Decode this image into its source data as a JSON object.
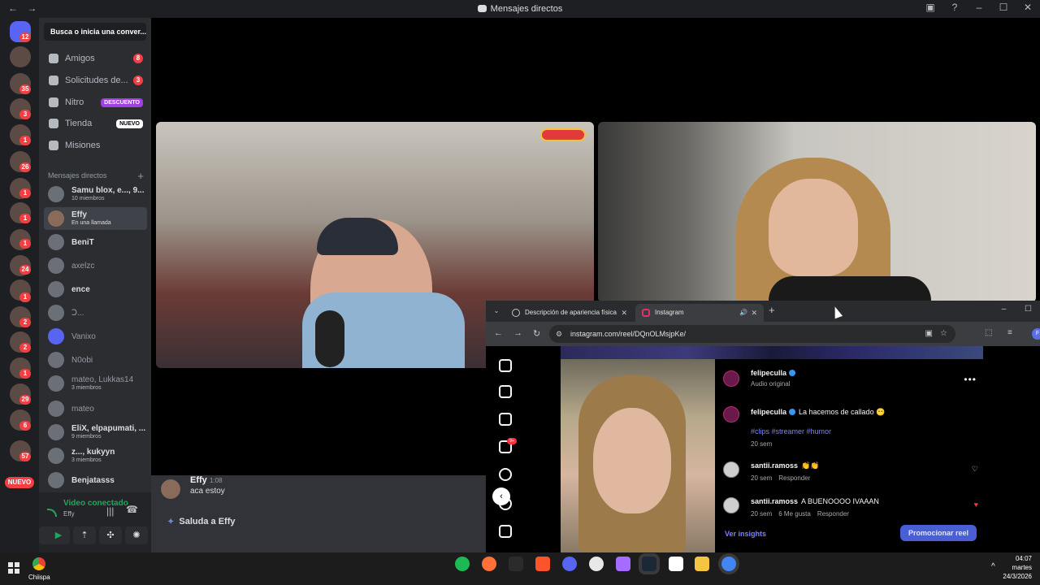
{
  "window": {
    "title": "Mensajes directos",
    "back": "←",
    "forward": "→",
    "controls": [
      "▣",
      "?",
      "–",
      "☐",
      "✕"
    ]
  },
  "rail": {
    "home_badge": "12",
    "badges": [
      "35",
      "3",
      "1",
      "26",
      "1",
      "1",
      "1",
      "24",
      "1",
      "2",
      "2",
      "1",
      "29",
      "6",
      "57"
    ],
    "new_label": "NUEVO"
  },
  "sidebar": {
    "search_placeholder": "Busca o inicia una conver...",
    "nav": [
      {
        "label": "Amigos",
        "count": "8"
      },
      {
        "label": "Solicitudes de...",
        "count": "3"
      },
      {
        "label": "Nitro",
        "tag": "DESCUENTO"
      },
      {
        "label": "Tienda",
        "tag": "NUEVO"
      },
      {
        "label": "Misiones"
      }
    ],
    "dm_header": "Mensajes directos",
    "dm_header_plus": "+",
    "dms": [
      {
        "name": "Samu blox, e..., 9...",
        "sub": "10 miembros"
      },
      {
        "name": "Effy",
        "sub": "En una llamada"
      },
      {
        "name": "BeniT"
      },
      {
        "name": "axelzc"
      },
      {
        "name": "ence"
      },
      {
        "name": "Ↄ..."
      },
      {
        "name": "Vanixo"
      },
      {
        "name": "N0obi"
      },
      {
        "name": "mateo, Lukkas14",
        "sub": "3 miembros"
      },
      {
        "name": "mateo"
      },
      {
        "name": "EliX, elpapumati, ...",
        "sub": "9 miembros"
      },
      {
        "name": "z..., kukyyn",
        "sub": "3 miembros"
      },
      {
        "name": "Benjatasss"
      }
    ]
  },
  "voice": {
    "status": "Video conectado",
    "channel": "Effy"
  },
  "chat": {
    "author": "Effy",
    "time": "1:08",
    "message": "aca estoy",
    "wave_label": "Saluda a Effy",
    "wave_icon": "✦"
  },
  "browser": {
    "tab_dropdown": "⌄",
    "tabs": [
      {
        "title": "Descripción de apariencia física",
        "close": "✕"
      },
      {
        "title": "Instagram",
        "close": "✕",
        "audio": "🔊"
      }
    ],
    "new_tab": "+",
    "url": "instagram.com/reel/DQnOLMsjpKe/",
    "profile_initial": "F",
    "nav": [
      "←",
      "→",
      "↻"
    ],
    "omni_icons": [
      "⚙",
      "▣",
      "☆"
    ],
    "ext_icons": [
      "⬚",
      "≡"
    ],
    "wctl": [
      "–",
      "☐"
    ]
  },
  "instagram": {
    "notif_badge": "9+",
    "scroll_icon": "‹",
    "more": "•••",
    "author": "felipeculla",
    "audio": "Audio original",
    "caption": "La hacemos de callado 😶",
    "hashtags": "#clips #streamer #humor",
    "caption_time": "20 sem",
    "comments": [
      {
        "user": "santii.ramoss",
        "text": "👏👏",
        "time": "20 sem",
        "likes": "",
        "reply": "Responder",
        "liked": false
      },
      {
        "user": "santii.ramoss",
        "text": "A BUENOOOO IVAAAN",
        "time": "20 sem",
        "likes": "6 Me gusta",
        "reply": "Responder",
        "liked": true
      }
    ],
    "heart_outline": "♡",
    "heart_filled": "♥",
    "insights": "Ver insights",
    "promote": "Promocionar reel"
  },
  "taskbar": {
    "pinned_label": "Chiispa",
    "clock_time": "04:07",
    "clock_day": "martes",
    "clock_date": "24/3/2026",
    "chevron": "^",
    "icon_colors": [
      "#1db954",
      "#ff7139",
      "#2b2b2b",
      "#fb542b",
      "#5865f2",
      "#e8e8e8",
      "#a66cff",
      "#1b2838",
      "#ffffff",
      "#f5c542",
      "#4285f4"
    ]
  }
}
